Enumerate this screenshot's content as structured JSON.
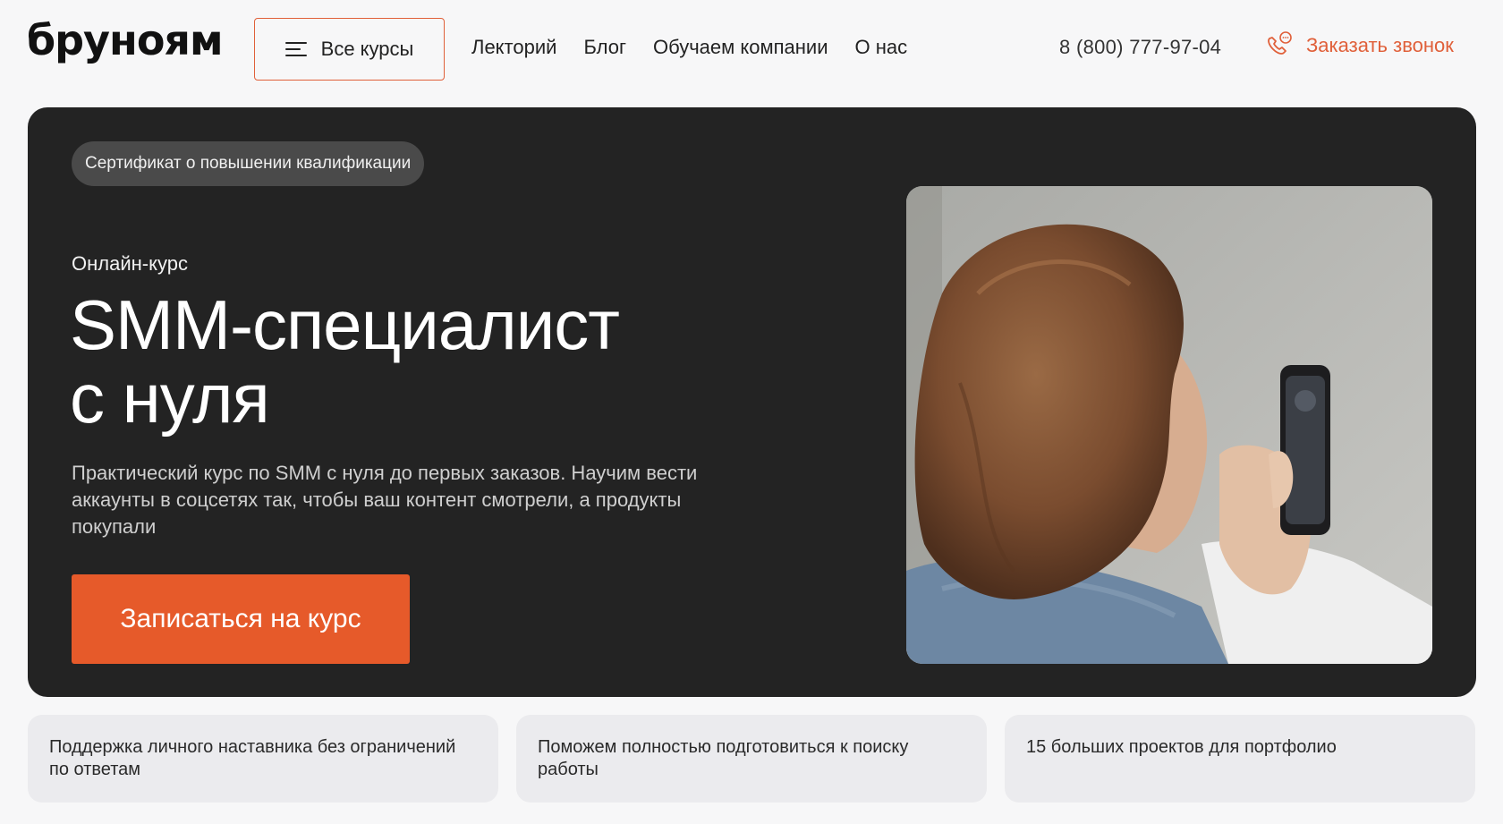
{
  "header": {
    "logo": "бруноям",
    "all_courses_label": "Все курсы",
    "nav": [
      "Лекторий",
      "Блог",
      "Обучаем компании",
      "О нас"
    ],
    "phone": "8 (800) 777-97-04",
    "callback_label": "Заказать звонок"
  },
  "hero": {
    "badge": "Сертификат о повышении квалификации",
    "kicker": "Онлайн-курс",
    "title_line1": "SMM-специалист",
    "title_line2": "с нуля",
    "description": "Практический курс по SMM с нуля до первых заказов. Научим вести аккаунты в соцсетях так, чтобы ваш контент смотрели, а продукты покупали",
    "cta_label": "Записаться на курс"
  },
  "features": [
    "Поддержка личного наставника без ограничений по ответам",
    "Поможем полностью подготовиться к поиску работы",
    "15 больших проектов для портфолио"
  ],
  "colors": {
    "accent": "#e65a2a",
    "hero_bg": "#232323",
    "page_bg": "#f7f7f8"
  }
}
